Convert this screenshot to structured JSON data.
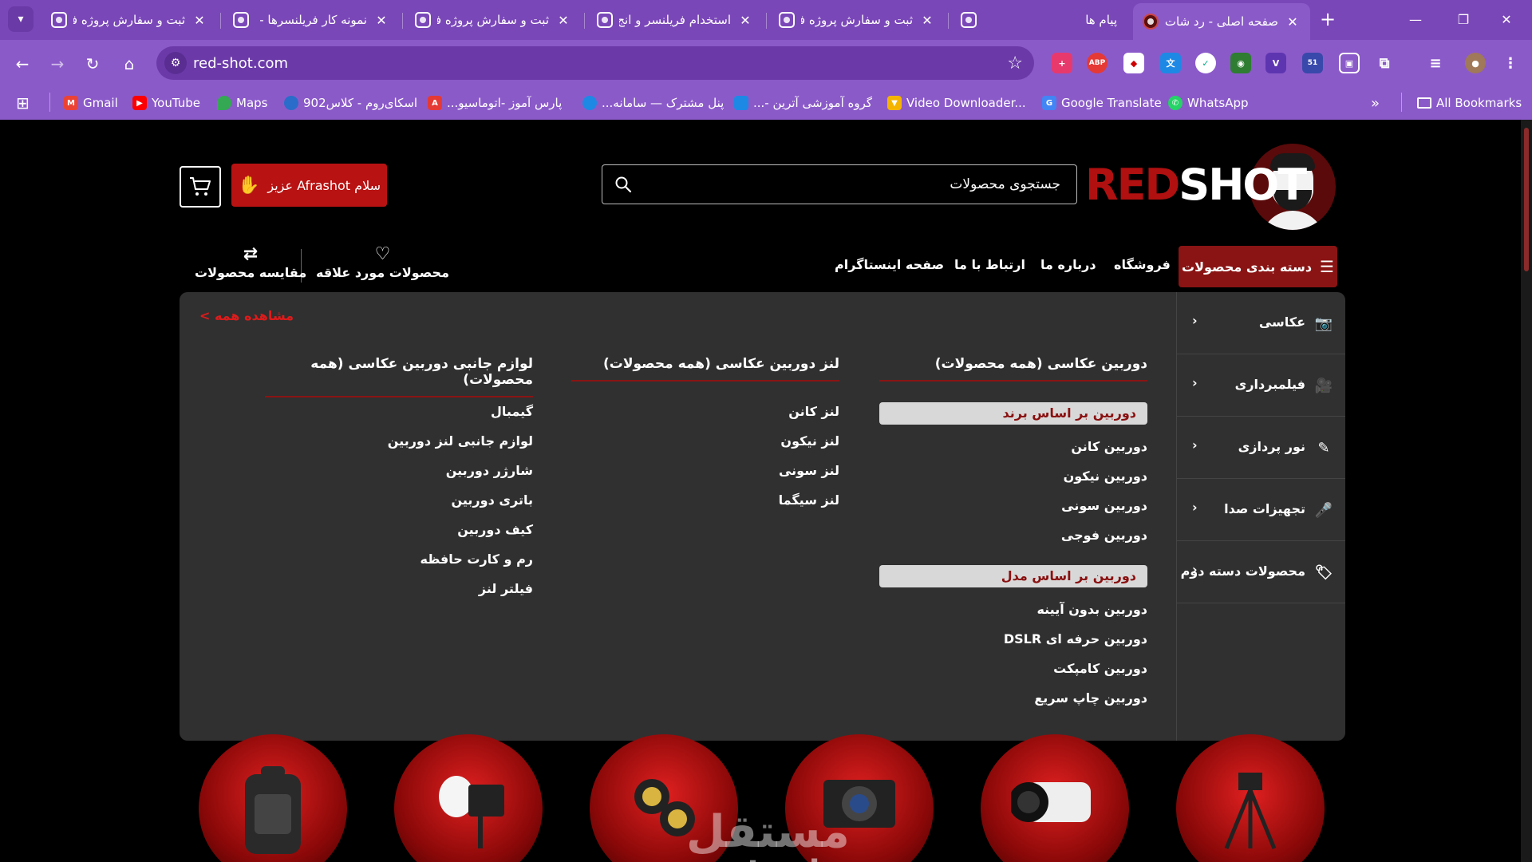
{
  "browser": {
    "tabs": [
      {
        "title": "ثبت و سفارش پروژه فر"
      },
      {
        "title": "نمونه کار فریلنسرها -"
      },
      {
        "title": "ثبت و سفارش پروژه فر"
      },
      {
        "title": "استخدام فریلنسر و انج"
      },
      {
        "title": "ثبت و سفارش پروژه فر"
      },
      {
        "title": "پیام ها"
      },
      {
        "title": "صفحه اصلی - رد شات"
      }
    ],
    "url": "red-shot.com",
    "bookmarks": [
      {
        "label": "Gmail",
        "icon": "gmail-icon",
        "color": "#ea4335"
      },
      {
        "label": "YouTube",
        "icon": "youtube-icon",
        "color": "#ff0000"
      },
      {
        "label": "Maps",
        "icon": "maps-icon",
        "color": "#34a853"
      },
      {
        "label": "اسکای‌روم - کلاس902",
        "icon": "skyroom-icon",
        "color": "#2a6cc9"
      },
      {
        "label": "پارس آموز -اتوماسیو...",
        "icon": "parsamooz-icon",
        "color": "#e53935"
      },
      {
        "label": "پنل مشترک — سامانه...",
        "icon": "globe-icon",
        "color": "#1e88e5"
      },
      {
        "label": "گروه آموزشی آترین -...",
        "icon": "atrin-icon",
        "color": "#1e88e5"
      },
      {
        "label": "Video Downloader...",
        "icon": "video-downloader-icon",
        "color": "#f4b400"
      },
      {
        "label": "Google Translate",
        "icon": "google-translate-icon",
        "color": "#4285f4"
      },
      {
        "label": "WhatsApp",
        "icon": "whatsapp-icon",
        "color": "#25d366"
      }
    ],
    "all_bookmarks": "All Bookmarks",
    "extension_badge": "51",
    "abp_label": "ABP"
  },
  "site": {
    "logo_red": "RED",
    "logo_white": "SHOT",
    "search_placeholder": "جستجوی محصولات",
    "greeting": "سلام Afrashot عزیز",
    "nav": {
      "categories": "دسته بندی محصولات",
      "shop": "فروشگاه",
      "about": "درباره ما",
      "contact": "ارتباط با ما",
      "instagram": "صفحه اینستاگرام",
      "favorites": "محصولات مورد علاقه",
      "compare": "مقایسه محصولات"
    },
    "side_menu": [
      {
        "label": "عکاسی",
        "icon": "camera-icon"
      },
      {
        "label": "فیلمبرداری",
        "icon": "video-camera-icon"
      },
      {
        "label": "نور پردازی",
        "icon": "lighting-icon"
      },
      {
        "label": "تجهیزات صدا",
        "icon": "microphone-icon"
      },
      {
        "label": "محصولات دسته دوم",
        "icon": "tag-icon"
      }
    ],
    "see_all": "مشاهده همه >",
    "columns": [
      {
        "title": "دوربین عکاسی (همه محصولات)",
        "groups": [
          {
            "heading": "دوربین بر اساس برند",
            "items": [
              "دوربین کانن",
              "دوربین نیکون",
              "دوربین سونی",
              "دوربین فوجی"
            ]
          },
          {
            "heading": "دوربین بر اساس مدل",
            "items": [
              "دوربین بدون آیینه",
              "دوربین حرفه ای DSLR",
              "دوربین کامپکت",
              "دوربین چاپ سریع"
            ]
          }
        ]
      },
      {
        "title": "لنز دوربین عکاسی (همه محصولات)",
        "items": [
          "لنز کانن",
          "لنز نیکون",
          "لنز سونی",
          "لنز سیگما"
        ]
      },
      {
        "title": "لوازم جانبی دوربین عکاسی (همه محصولات)",
        "items": [
          "گیمبال",
          "لوازم جانبی لنز دوربین",
          "شارژر دوربین",
          "باتری دوربین",
          "کیف دوربین",
          "رم و کارت حافظه",
          "فیلتر لنز"
        ]
      }
    ],
    "watermark": "mostaql.com",
    "watermark_ar": "مستقل"
  },
  "colors": {
    "chrome_dark": "#7a47b8",
    "chrome_light": "#8b5ac9",
    "brand_red": "#b81212",
    "brand_dark_red": "#8a1414",
    "panel": "#303030"
  }
}
